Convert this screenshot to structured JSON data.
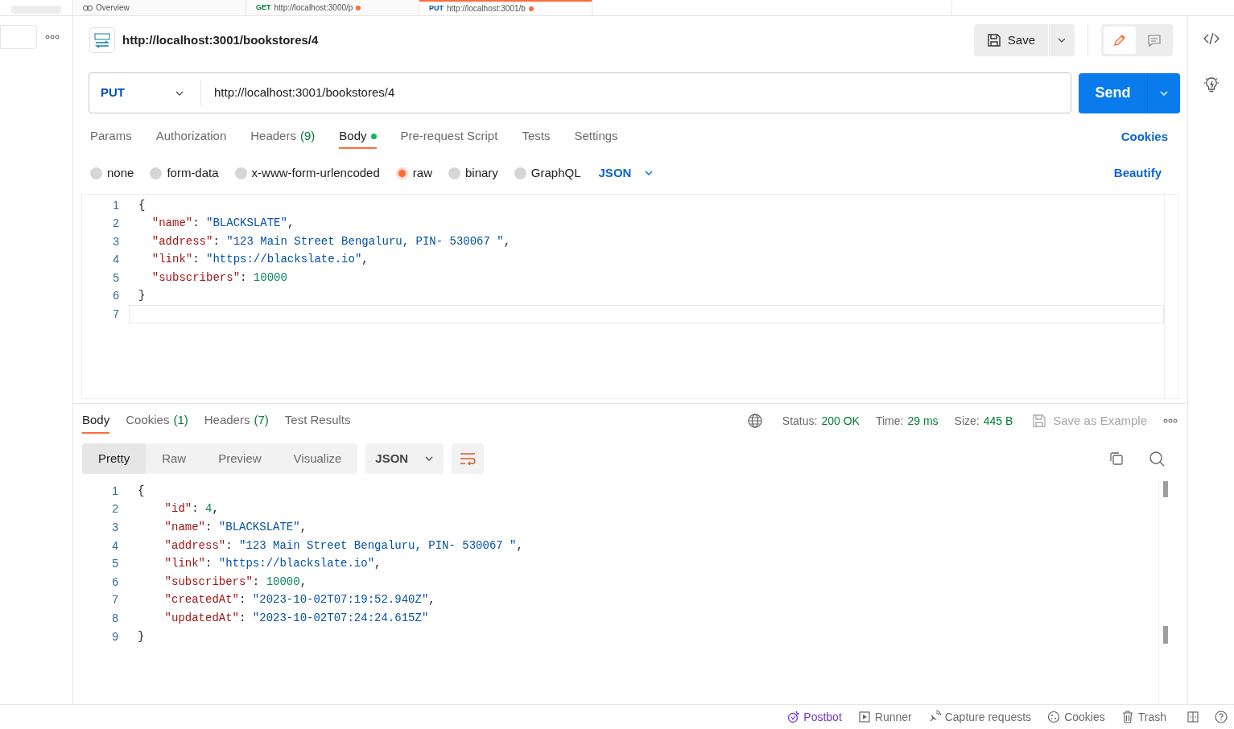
{
  "tabs": [
    {
      "label": "Overview",
      "selected": false
    },
    {
      "method": "GET",
      "label": "http://localhost:3000/p",
      "selected": false,
      "unsaved": true
    },
    {
      "method": "PUT",
      "label": "http://localhost:3001/b",
      "selected": true,
      "unsaved": true
    }
  ],
  "request": {
    "title": "http://localhost:3001/bookstores/4",
    "save": "Save",
    "method": "PUT",
    "url": "http://localhost:3001/bookstores/4",
    "send": "Send"
  },
  "request_tabs": [
    {
      "label": "Params",
      "selected": false
    },
    {
      "label": "Authorization",
      "selected": false
    },
    {
      "label": "Headers",
      "count": "(9)",
      "selected": false
    },
    {
      "label": "Body",
      "selected": true,
      "dot": true
    },
    {
      "label": "Pre-request Script",
      "selected": false
    },
    {
      "label": "Tests",
      "selected": false
    },
    {
      "label": "Settings",
      "selected": false
    }
  ],
  "cookies_link": "Cookies",
  "body_modes": [
    {
      "label": "none",
      "selected": false
    },
    {
      "label": "form-data",
      "selected": false
    },
    {
      "label": "x-www-form-urlencoded",
      "selected": false
    },
    {
      "label": "raw",
      "selected": true
    },
    {
      "label": "binary",
      "selected": false
    },
    {
      "label": "GraphQL",
      "selected": false
    }
  ],
  "body_format": "JSON",
  "beautify": "Beautify",
  "request_body": [
    {
      "n": "1",
      "text": "{"
    },
    {
      "n": "2",
      "text": "  \"name\": \"BLACKSLATE\","
    },
    {
      "n": "3",
      "text": "  \"address\": \"123 Main Street Bengaluru, PIN- 530067 \","
    },
    {
      "n": "4",
      "text": "  \"link\": \"https://blackslate.io\","
    },
    {
      "n": "5",
      "text": "  \"subscribers\": 10000"
    },
    {
      "n": "6",
      "text": "}"
    },
    {
      "n": "7",
      "current": true
    }
  ],
  "response_tabs": [
    {
      "label": "Body",
      "selected": true
    },
    {
      "label": "Cookies",
      "count": "(1)",
      "selected": false
    },
    {
      "label": "Headers",
      "count": "(7)",
      "selected": false
    },
    {
      "label": "Test Results",
      "selected": false
    }
  ],
  "metrics": [
    {
      "label": "Status:",
      "value": "200 OK"
    },
    {
      "label": "Time:",
      "value": "29 ms"
    },
    {
      "label": "Size:",
      "value": "445 B"
    }
  ],
  "save_example": "Save as Example",
  "view_modes": [
    {
      "label": "Pretty",
      "selected": true
    },
    {
      "label": "Raw",
      "selected": false
    },
    {
      "label": "Preview",
      "selected": false
    },
    {
      "label": "Visualize",
      "selected": false
    }
  ],
  "response_format": "JSON",
  "response_body": [
    {
      "n": "1",
      "text": "{"
    },
    {
      "n": "2",
      "text": "    \"id\": 4,"
    },
    {
      "n": "3",
      "text": "    \"name\": \"BLACKSLATE\","
    },
    {
      "n": "4",
      "text": "    \"address\": \"123 Main Street Bengaluru, PIN- 530067 \","
    },
    {
      "n": "5",
      "text": "    \"link\": \"https://blackslate.io\","
    },
    {
      "n": "6",
      "text": "    \"subscribers\": 10000,"
    },
    {
      "n": "7",
      "text": "    \"createdAt\": \"2023-10-02T07:19:52.940Z\","
    },
    {
      "n": "8",
      "text": "    \"updatedAt\": \"2023-10-02T07:24:24.615Z\""
    },
    {
      "n": "9",
      "text": "}"
    }
  ],
  "footer": [
    {
      "kind": "postbot",
      "label": "Postbot"
    },
    {
      "kind": "runner",
      "label": "Runner"
    },
    {
      "kind": "capture",
      "label": "Capture requests"
    },
    {
      "kind": "cookies",
      "label": "Cookies"
    },
    {
      "kind": "trash",
      "label": "Trash"
    }
  ]
}
